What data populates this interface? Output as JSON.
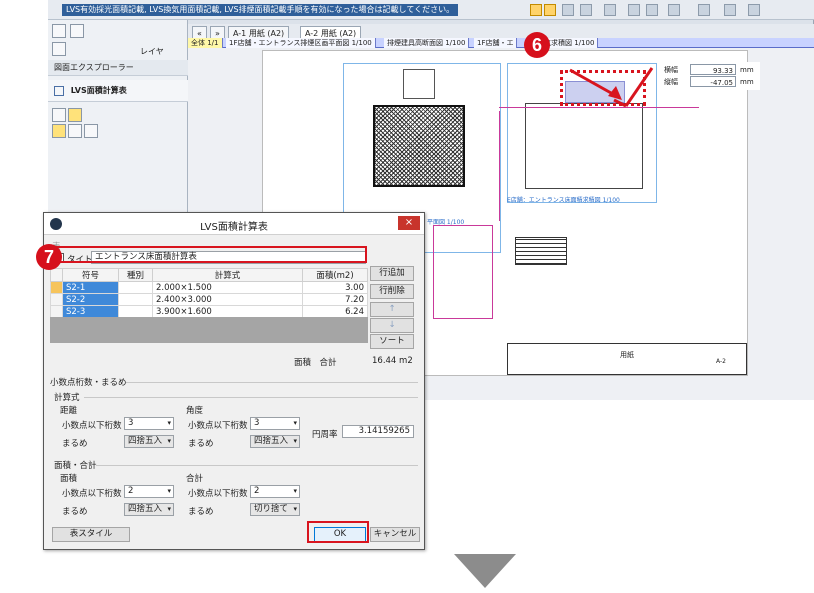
{
  "app": {
    "status_message": "LVS有効採光面積記載, LVS換気用面積記載, LVS排煙面積記載手順を有効になった場合は記載してください。",
    "left_panel": {
      "explorer_label": "図面エクスプローラー",
      "calc_label": "LVS面積計算表",
      "layer_label": "レイヤ"
    },
    "tabs": [
      {
        "label": "A-1 用紙 (A2)"
      },
      {
        "label": "A-2 用紙 (A2)"
      }
    ],
    "sheet_tabs": [
      "全体 1/1",
      "1F店舗・エントランス排煙区画平面図 1/100",
      "排煙建具高断面図 1/100",
      "1F店舗・エ",
      "換気求積図 1/100"
    ],
    "readout": {
      "width_label": "横幅",
      "width_value": "93.33",
      "height_label": "縦幅",
      "height_value": "-47.05",
      "unit": "mm"
    },
    "drawing": {
      "plan_label_1": "平面図 1/100",
      "plan_label_2": "E店舗：エントランス床面積求積図 1/100",
      "titleblock_label": "用紙",
      "sheet_no": "A-2"
    }
  },
  "callouts": {
    "six": "6",
    "seven": "7"
  },
  "dialog": {
    "title": "LVS面積計算表",
    "close": "×",
    "title_checkbox_label": "タイトル",
    "title_value": "エントランス床面積計算表",
    "table": {
      "headers": [
        "符号",
        "種別",
        "計算式",
        "面積(m2)"
      ],
      "rows": [
        {
          "code": "S2-1",
          "kind": "",
          "formula": "2.000×1.500",
          "area": "3.00"
        },
        {
          "code": "S2-2",
          "kind": "",
          "formula": "2.400×3.000",
          "area": "7.20"
        },
        {
          "code": "S2-3",
          "kind": "",
          "formula": "3.900×1.600",
          "area": "6.24"
        }
      ]
    },
    "side_buttons": {
      "add_row": "行追加",
      "delete_row": "行削除",
      "up": "↑",
      "down": "↓",
      "sort": "ソート"
    },
    "total_label": "面積　合計",
    "total_value": "16.44 m2",
    "rounding_section": "小数点桁数・まるめ",
    "formula_section": "計算式",
    "distance_group": "距離",
    "angle_group": "角度",
    "decimals_label": "小数点以下桁数",
    "rounding_label": "まるめ",
    "distance_decimals": "3",
    "distance_rounding": "四捨五入",
    "angle_decimals": "3",
    "angle_rounding": "四捨五入",
    "pi_label": "円周率",
    "pi_value": "3.14159265",
    "area_total_section": "面積・合計",
    "area_group": "面積",
    "sum_group": "合計",
    "area_decimals": "2",
    "area_rounding": "四捨五入",
    "sum_decimals": "2",
    "sum_rounding": "切り捨て",
    "table_style_button": "表スタイル",
    "ok_button": "OK",
    "cancel_button": "キャンセル"
  }
}
